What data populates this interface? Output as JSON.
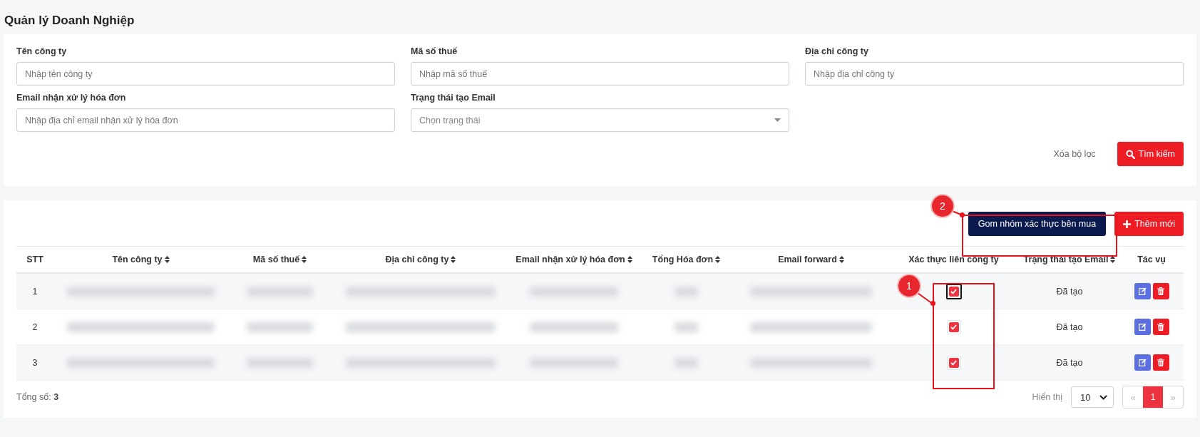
{
  "page_title": "Quản lý Doanh Nghiệp",
  "filters": [
    {
      "label": "Tên công ty",
      "kind": "text",
      "placeholder": "Nhập tên công ty"
    },
    {
      "label": "Mã số thuế",
      "kind": "text",
      "placeholder": "Nhập mã số thuế"
    },
    {
      "label": "Địa chỉ công ty",
      "kind": "text",
      "placeholder": "Nhập địa chỉ công ty"
    },
    {
      "label": "Email nhận xử lý hóa đơn",
      "kind": "text",
      "placeholder": "Nhập địa chỉ email nhận xử lý hóa đơn"
    },
    {
      "label": "Trạng thái tạo Email",
      "kind": "select",
      "placeholder": "Chọn trạng thái"
    }
  ],
  "clear_filter": "Xóa bộ lọc",
  "search_button": "Tìm kiếm",
  "group_button": "Gom nhóm xác thực bên mua",
  "add_button": "Thêm mới",
  "table": {
    "columns": [
      {
        "label": "STT",
        "kind": "index",
        "sortable": false
      },
      {
        "label": "Tên công ty",
        "kind": "redacted",
        "sortable": true
      },
      {
        "label": "Mã số thuế",
        "kind": "redacted",
        "sortable": true
      },
      {
        "label": "Địa chỉ công ty",
        "kind": "redacted",
        "sortable": true
      },
      {
        "label": "Email nhận xử lý hóa đơn",
        "kind": "redacted",
        "sortable": true
      },
      {
        "label": "Tổng Hóa đơn",
        "kind": "redacted",
        "sortable": true
      },
      {
        "label": "Email forward",
        "kind": "redacted",
        "sortable": true
      },
      {
        "label": "Xác thực liên công ty",
        "kind": "check",
        "sortable": false
      },
      {
        "label": "Trạng thái tạo Email",
        "kind": "status",
        "sortable": true
      },
      {
        "label": "Tác vụ",
        "kind": "actions",
        "sortable": false
      }
    ],
    "rows": [
      {
        "stt": "1",
        "verified": true,
        "focused": true,
        "status": "Đã tạo"
      },
      {
        "stt": "2",
        "verified": true,
        "focused": false,
        "status": "Đã tạo"
      },
      {
        "stt": "3",
        "verified": true,
        "focused": false,
        "status": "Đã tạo"
      }
    ]
  },
  "total_label": "Tổng số:",
  "total_value": "3",
  "page_size_label": "Hiển thị",
  "page_size": "10",
  "pagination": [
    {
      "label": "«",
      "kind": "prev",
      "disabled": true,
      "selected": false
    },
    {
      "label": "1",
      "kind": "page",
      "disabled": false,
      "selected": true
    },
    {
      "label": "»",
      "kind": "next",
      "disabled": true,
      "selected": false
    }
  ],
  "annotations": [
    {
      "label": "1",
      "kind": "check-column"
    },
    {
      "label": "2",
      "kind": "group-button"
    }
  ]
}
